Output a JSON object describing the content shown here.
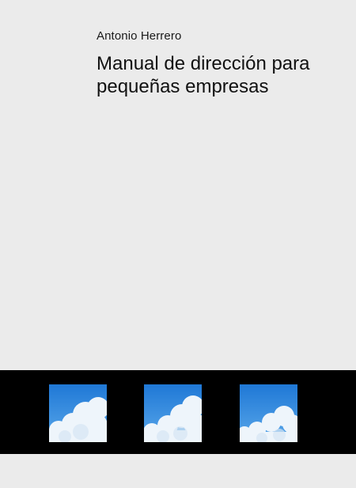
{
  "book": {
    "author": "Antonio Herrero",
    "title": "Manual de dirección para pequeñas empresas"
  },
  "colors": {
    "background": "#ebebeb",
    "band": "#000000",
    "sky": "#2d86d9",
    "cloud": "#eef5fb"
  },
  "images": [
    {
      "name": "sky-clouds-image-1"
    },
    {
      "name": "sky-clouds-image-2"
    },
    {
      "name": "sky-clouds-image-3"
    }
  ]
}
